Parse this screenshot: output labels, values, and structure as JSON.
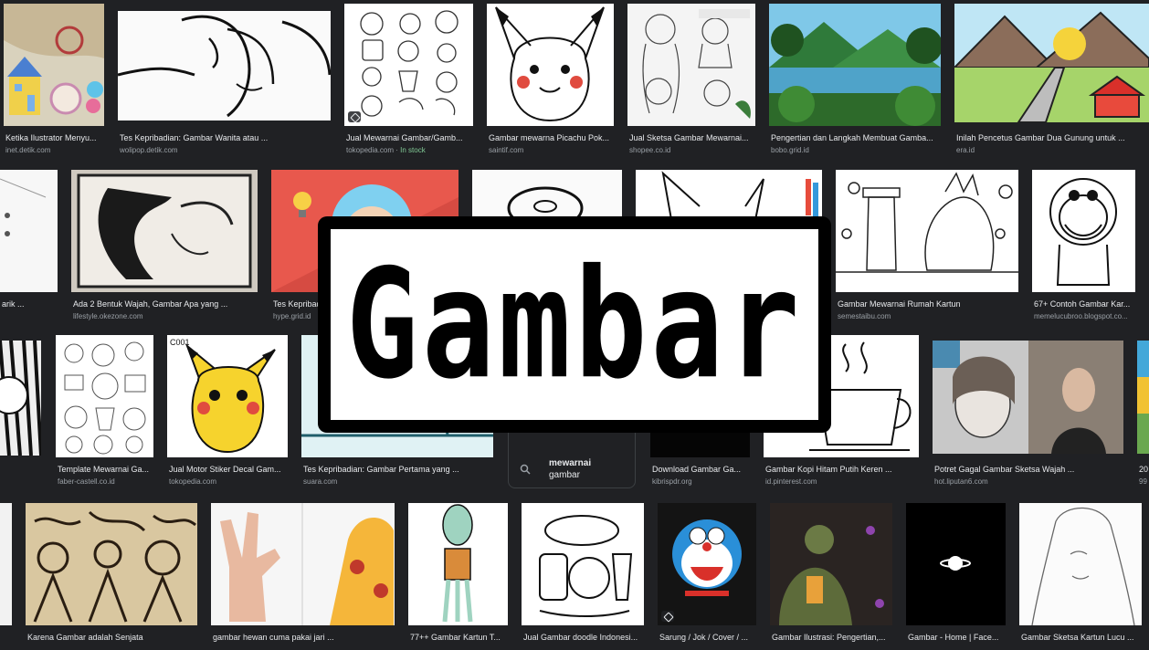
{
  "results": [
    {
      "id": "r1c1",
      "caption": "Ketika Ilustrator Menyu...",
      "source": "inet.detik.com"
    },
    {
      "id": "r1c2",
      "caption": "Tes Kepribadian: Gambar Wanita atau ...",
      "source": "wolipop.detik.com"
    },
    {
      "id": "r1c3",
      "caption": "Jual Mewarnai Gambar/Gamb...",
      "source": "tokopedia.com",
      "stock": "In stock"
    },
    {
      "id": "r1c4",
      "caption": "Gambar mewarna Picachu Pok...",
      "source": "saintif.com"
    },
    {
      "id": "r1c5",
      "caption": "Jual Sketsa Gambar Mewarnai...",
      "source": "shopee.co.id"
    },
    {
      "id": "r1c6",
      "caption": "Pengertian dan Langkah Membuat Gamba...",
      "source": "bobo.grid.id"
    },
    {
      "id": "r1c7",
      "caption": "Inilah Pencetus Gambar Dua Gunung untuk ...",
      "source": "era.id"
    },
    {
      "id": "r2c1",
      "caption": "arik ...",
      "source": ""
    },
    {
      "id": "r2c2",
      "caption": "Ada 2 Bentuk Wajah, Gambar Apa yang ...",
      "source": "lifestyle.okezone.com"
    },
    {
      "id": "r2c3",
      "caption": "Tes Kepribadian: Gambar Pertam...",
      "source": "hype.grid.id"
    },
    {
      "id": "r2c6",
      "caption": "Gambar Mewarnai Rumah Kartun",
      "source": "semestaibu.com"
    },
    {
      "id": "r2c7",
      "caption": "67+ Contoh Gambar Kar...",
      "source": "memelucubroo.blogspot.co..."
    },
    {
      "id": "r3c2",
      "caption": "Template Mewarnai Ga...",
      "source": "faber-castell.co.id"
    },
    {
      "id": "r3c3",
      "caption": "Jual Motor Stiker Decal Gam...",
      "source": "tokopedia.com"
    },
    {
      "id": "r3c4",
      "caption": "Tes Kepribadian: Gambar Pertama yang ...",
      "source": "suara.com"
    },
    {
      "id": "r3c6",
      "caption": "Download Gambar Ga...",
      "source": "kibrispdr.org"
    },
    {
      "id": "r3c7",
      "caption": "Gambar Kopi Hitam Putih Keren ...",
      "source": "id.pinterest.com"
    },
    {
      "id": "r3c8",
      "caption": "Potret Gagal Gambar Sketsa Wajah ...",
      "source": "hot.liputan6.com"
    },
    {
      "id": "r3c9",
      "caption": "20",
      "source": "99"
    },
    {
      "id": "r4c2",
      "caption": "Karena Gambar adalah Senjata",
      "source": ""
    },
    {
      "id": "r4c3",
      "caption": "gambar hewan cuma pakai jari ...",
      "source": ""
    },
    {
      "id": "r4c4",
      "caption": "77++ Gambar Kartun T...",
      "source": ""
    },
    {
      "id": "r4c5",
      "caption": "Jual Gambar doodle Indonesi...",
      "source": ""
    },
    {
      "id": "r4c6",
      "caption": "Sarung / Jok / Cover / ...",
      "source": ""
    },
    {
      "id": "r4c7",
      "caption": "Gambar Ilustrasi: Pengertian,...",
      "source": ""
    },
    {
      "id": "r4c8",
      "caption": "Gambar - Home | Face...",
      "source": ""
    },
    {
      "id": "r4c9",
      "caption": "Gambar Sketsa Kartun Lucu ...",
      "source": ""
    }
  ],
  "c001_label": "C001",
  "related_search": {
    "line1": "mewarnai",
    "line2": "gambar"
  },
  "overlay_title": "Gambar",
  "colors": {
    "background": "#202124",
    "caption": "#e8eaed",
    "source": "#9aa0a6",
    "in_stock": "#81c995"
  }
}
